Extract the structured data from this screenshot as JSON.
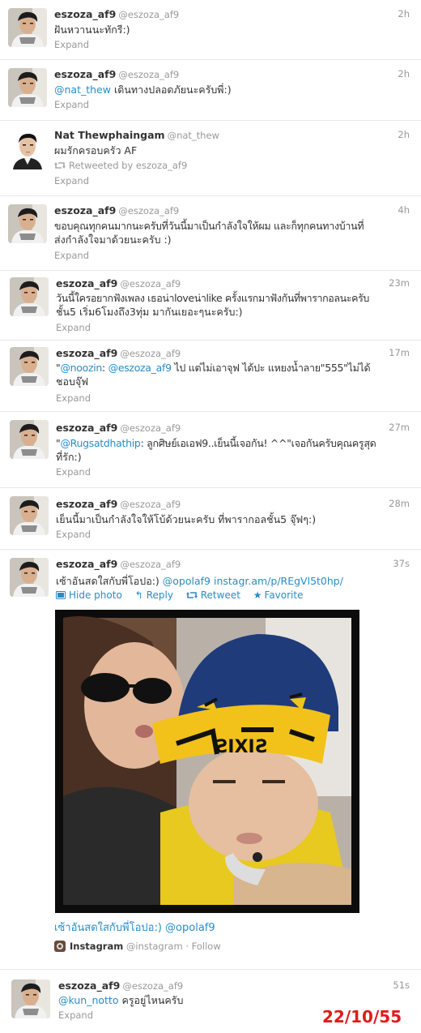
{
  "tweets": [
    {
      "name": "eszoza_af9",
      "handle": "@eszoza_af9",
      "time": "2h",
      "text": "ฝันหวานนะทักรี:)",
      "expand": "Expand"
    },
    {
      "name": "eszoza_af9",
      "handle": "@eszoza_af9",
      "time": "2h",
      "mention": "@nat_thew",
      "text": " เดินทางปลอดภัยนะครับพี่:)",
      "expand": "Expand"
    },
    {
      "name": "Nat Thewphaingam",
      "handle": "@nat_thew",
      "time": "2h",
      "text": "ผมรักครอบครัว AF",
      "retweeted": "Retweeted by eszoza_af9",
      "expand": "Expand"
    },
    {
      "name": "eszoza_af9",
      "handle": "@eszoza_af9",
      "time": "4h",
      "text1": "ขอบคุณทุกคนมากนะครับที่วันนี้มาเป็นกำลังใจให้ผม และก็ทุกคนทางบ้านที่",
      "text2": "ส่งกำลังใจมาด้วยนะครับ :)",
      "expand": "Expand"
    },
    {
      "name": "eszoza_af9",
      "handle": "@eszoza_af9",
      "time": "23m",
      "text1": "วันนี้ใครอยากฟังเพลง เธอน่าloveน่าlike ครั้งแรกมาฟังกันที่พารากอลนะครับ",
      "text2": "ชั้น5 เริ่ม6โมงถึง3ทุ่ม มากันเยอะๆนะครับ:)",
      "expand": "Expand"
    },
    {
      "name": "eszoza_af9",
      "handle": "@eszoza_af9",
      "time": "17m",
      "mention1": "@noozin",
      "sep": ": ",
      "mention2": "@eszoza_af9",
      "text1": " ไป แต่ไม่เอาจุฟ ได้ปะ แหยงน้ำลาย\"555\"ไม่ได้",
      "text2": "ชอบจุ๊ฟ",
      "expand": "Expand"
    },
    {
      "name": "eszoza_af9",
      "handle": "@eszoza_af9",
      "time": "27m",
      "mention": "@Rugsatdhathip",
      "text1": ": ลูกศิษย์เอเอฟ9..เย็นนี้เจอกัน! ^^\"เจอกันครับคุณครูสุด",
      "text2": "ที่รัก:)",
      "expand": "Expand"
    },
    {
      "name": "eszoza_af9",
      "handle": "@eszoza_af9",
      "time": "28m",
      "text": "เย็นนี้มาเป็นกำลังใจให้โบ้ด้วยนะครับ ที่พารากอลชั้น5 จุ๊ฟๆ:)",
      "expand": "Expand"
    },
    {
      "name": "eszoza_af9",
      "handle": "@eszoza_af9",
      "time": "37s",
      "text": "เซ้าอันสดใสกับพี่โอปอ:) ",
      "mention": "@opolaf9",
      "link": " instagr.am/p/REgVl5t0hp/",
      "actions": {
        "hide_photo": "Hide photo",
        "reply": "Reply",
        "retweet": "Retweet",
        "favorite": "Favorite"
      },
      "cap_logo": "SIXIS",
      "caption_prefix": "เซ้าอันสดใสกับพี่โอปอ:) ",
      "caption_mention": "@opolaf9",
      "source_name": "Instagram",
      "source_handle": "@instagram",
      "source_follow": " · Follow"
    },
    {
      "name": "eszoza_af9",
      "handle": "@eszoza_af9",
      "time": "51s",
      "mention": "@kun_notto",
      "text": " ครูอยู่ไหนครับ",
      "expand": "Expand"
    }
  ],
  "date_stamp": "22/10/55",
  "colors": {
    "link": "#2a8cc6",
    "stamp": "#e01b1b",
    "meta": "#999999"
  }
}
